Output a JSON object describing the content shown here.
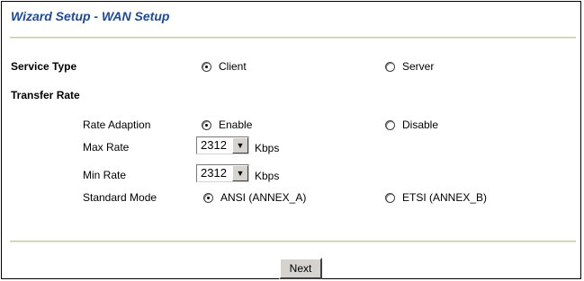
{
  "header": {
    "title": "Wizard Setup - WAN Setup"
  },
  "service_type": {
    "label": "Service Type",
    "options": [
      {
        "label": "Client",
        "selected": true
      },
      {
        "label": "Server",
        "selected": false
      }
    ]
  },
  "transfer_rate": {
    "label": "Transfer Rate",
    "rate_adaption": {
      "label": "Rate Adaption",
      "options": [
        {
          "label": "Enable",
          "selected": true
        },
        {
          "label": "Disable",
          "selected": false
        }
      ]
    },
    "max_rate": {
      "label": "Max Rate",
      "value": "2312",
      "unit": "Kbps"
    },
    "min_rate": {
      "label": "Min Rate",
      "value": "2312",
      "unit": "Kbps"
    },
    "standard_mode": {
      "label": "Standard Mode",
      "options": [
        {
          "label": "ANSI (ANNEX_A)",
          "selected": true
        },
        {
          "label": "ETSI (ANNEX_B)",
          "selected": false
        }
      ]
    }
  },
  "footer": {
    "next_label": "Next"
  },
  "colors": {
    "title": "#1c4a97",
    "rule": "#c7cba2"
  }
}
